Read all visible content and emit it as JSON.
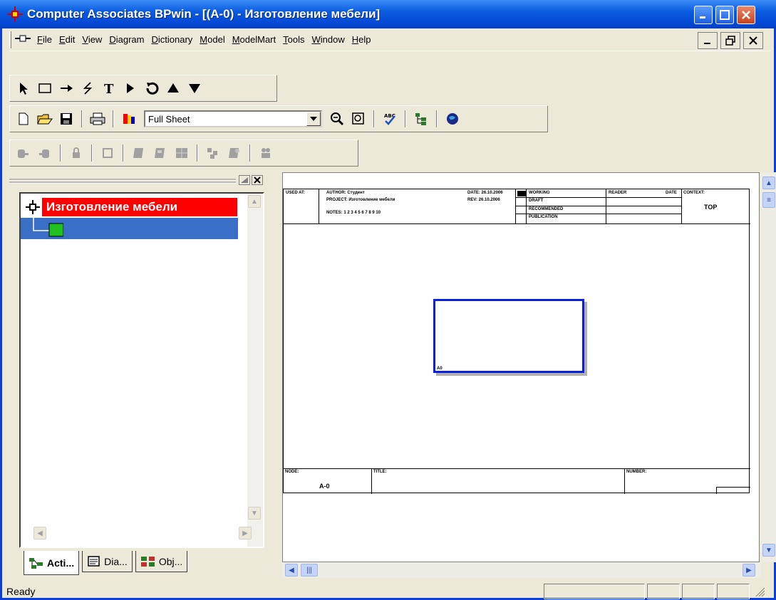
{
  "window": {
    "title": "Computer Associates BPwin - [(A-0)  - Изготовление мебели]"
  },
  "menu": [
    "File",
    "Edit",
    "View",
    "Diagram",
    "Dictionary",
    "Model",
    "ModelMart",
    "Tools",
    "Window",
    "Help"
  ],
  "toolbar2": {
    "zoom_value": "Full Sheet"
  },
  "explorer": {
    "root_label": "Изготовление мебели",
    "tabs": [
      "Acti...",
      "Dia...",
      "Obj..."
    ]
  },
  "sheet": {
    "used_at": "USED AT:",
    "author": "AUTHOR: Студент",
    "project": "PROJECT: Изготовление мебели",
    "notes": "NOTES: 1 2 3 4 5 6 7 8 9 10",
    "date": "DATE: 26.10.2006",
    "rev": "REV: 26.10.2006",
    "working": "WORKING",
    "draft": "DRAFT",
    "recommended": "RECOMMENDED",
    "publication": "PUBLICATION",
    "reader": "READER",
    "reader_date": "DATE",
    "context": "CONTEXT:",
    "context_value": "TOP",
    "node": "NODE:",
    "node_value": "A-0",
    "title": "TITLE:",
    "number": "NUMBER:",
    "box_label": "A0"
  },
  "status": {
    "text": "Ready"
  }
}
